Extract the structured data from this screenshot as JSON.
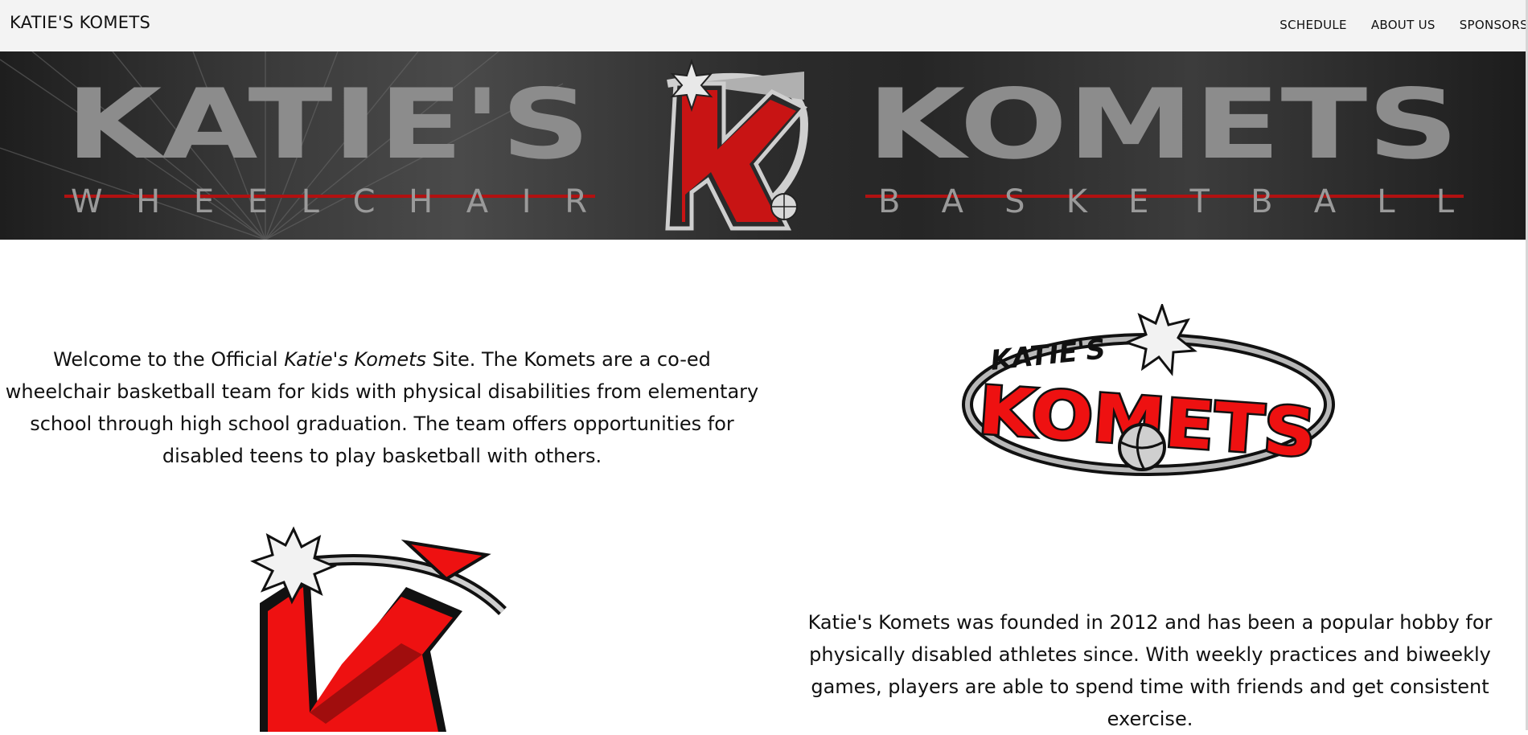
{
  "header": {
    "brand": "KATIE'S KOMETS",
    "nav": [
      {
        "label": "SCHEDULE"
      },
      {
        "label": "ABOUT US"
      },
      {
        "label": "SPONSORS"
      }
    ]
  },
  "banner": {
    "word_left": "KATIE'S",
    "word_right": "KOMETS",
    "sub_left": "W H E E L C H A I R",
    "sub_right": "B A S K E T B A L L",
    "logo_letter": "K"
  },
  "intro": {
    "before": "Welcome to the Official ",
    "italic": "Katie's Komets",
    "after": " Site. The Komets are a co-ed wheelchair basketball team for kids with physical disabilities from elementary school through high school graduation. The team offers opportunities for disabled teens to play basketball with others."
  },
  "logo": {
    "small_text": "KATIE'S",
    "big_text": "KOMETS",
    "letter": "K"
  },
  "history": {
    "text": "Katie's Komets was founded in 2012 and has been a popular hobby for physically disabled athletes since. With weekly practices and biweekly games, players are able to spend time with friends and get consistent exercise."
  },
  "colors": {
    "red": "#e01010",
    "dark_red": "#8a0a0a",
    "grey_text": "#8c8c8c",
    "nav_bg": "#f3f3f3"
  },
  "icons": [
    "komet-star-icon",
    "basketball-icon"
  ]
}
